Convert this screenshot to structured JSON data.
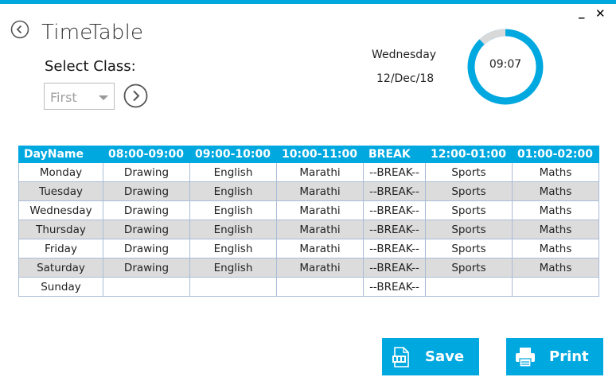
{
  "window": {
    "minimize_glyph": "_",
    "close_glyph": "✕"
  },
  "header": {
    "title": "TimeTable"
  },
  "class_selector": {
    "label": "Select Class:",
    "value": "First"
  },
  "clock": {
    "day": "Wednesday",
    "date": "12/Dec/18",
    "time": "09:07",
    "progress_fraction": 0.12,
    "accent_color": "#00a8e0"
  },
  "timetable": {
    "headers": [
      "DayName",
      "08:00-09:00",
      "09:00-10:00",
      "10:00-11:00",
      "BREAK",
      "12:00-01:00",
      "01:00-02:00"
    ],
    "rows": [
      [
        "Monday",
        "Drawing",
        "English",
        "Marathi",
        "--BREAK--",
        "Sports",
        "Maths"
      ],
      [
        "Tuesday",
        "Drawing",
        "English",
        "Marathi",
        "--BREAK--",
        "Sports",
        "Maths"
      ],
      [
        "Wednesday",
        "Drawing",
        "English",
        "Marathi",
        "--BREAK--",
        "Sports",
        "Maths"
      ],
      [
        "Thursday",
        "Drawing",
        "English",
        "Marathi",
        "--BREAK--",
        "Sports",
        "Maths"
      ],
      [
        "Friday",
        "Drawing",
        "English",
        "Marathi",
        "--BREAK--",
        "Sports",
        "Maths"
      ],
      [
        "Saturday",
        "Drawing",
        "English",
        "Marathi",
        "--BREAK--",
        "Sports",
        "Maths"
      ],
      [
        "Sunday",
        "",
        "",
        "",
        "--BREAK--",
        "",
        ""
      ]
    ]
  },
  "actions": {
    "save_label": "Save",
    "save_icon": "pdf-file-icon",
    "print_label": "Print",
    "print_icon": "printer-icon"
  },
  "colors": {
    "accent": "#00a8e0",
    "row_alt": "#dcdcdc"
  }
}
